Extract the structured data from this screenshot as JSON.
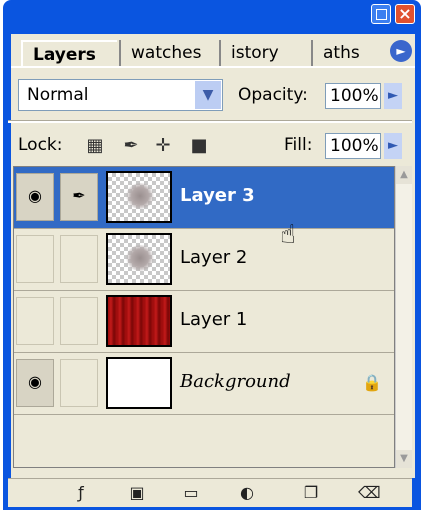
{
  "tabs": [
    "Layers",
    "watches",
    "istory",
    "aths"
  ],
  "blend_mode": "Normal",
  "opacity_label": "Opacity:",
  "opacity_value": "100%",
  "lock_label": "Lock:",
  "fill_label": "Fill:",
  "fill_value": "100%",
  "layers": [
    {
      "name": "Layer 3",
      "selected": true,
      "visible": true,
      "thumb": "brush-blob"
    },
    {
      "name": "Layer 2",
      "selected": false,
      "visible": false,
      "thumb": "brush-blob"
    },
    {
      "name": "Layer 1",
      "selected": false,
      "visible": false,
      "thumb": "red-curtain"
    },
    {
      "name": "Background",
      "selected": false,
      "visible": true,
      "thumb": "white",
      "locked": true
    }
  ],
  "icons": {
    "eye": "eye-icon",
    "brush": "brush-link-icon",
    "lock_transparent": "lock-transparent-icon",
    "lock_image": "lock-image-icon",
    "lock_position": "lock-position-icon",
    "lock_all": "lock-all-icon",
    "bottom": [
      "layer-style-icon",
      "layer-mask-icon",
      "new-set-icon",
      "adjustment-layer-icon",
      "new-layer-icon",
      "trash-icon"
    ]
  },
  "colors": {
    "selection": "#316ac5",
    "titlebar": "#0a55e0"
  }
}
